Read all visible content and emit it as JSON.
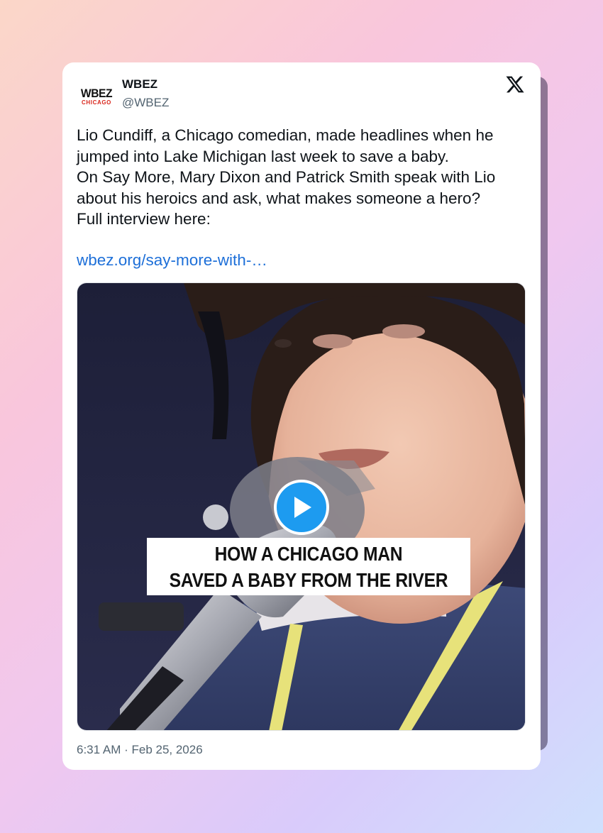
{
  "tweet": {
    "avatar": {
      "logo_main": "WBEZ",
      "logo_sub": "CHICAGO"
    },
    "display_name": "WBEZ",
    "handle": "@WBEZ",
    "text_lines": [
      "Lio Cundiff, a Chicago comedian, made headlines when he",
      "jumped into Lake Michigan last week to save a baby.",
      "On Say More, Mary Dixon and Patrick Smith speak with Lio",
      "about his heroics and ask, what makes someone a hero?",
      "Full interview here:"
    ],
    "link": "wbez.org/say-more-with-…",
    "video": {
      "caption_lines": [
        "HOW A CHICAGO MAN",
        "SAVED A BABY FROM THE RIVER"
      ]
    },
    "timestamp": "6:31 AM · Feb 25, 2026"
  },
  "icons": {
    "platform": "x-logo-icon",
    "play": "play-icon"
  },
  "colors": {
    "link": "#1d6fd8",
    "play_button": "#1d9bf0",
    "logo_red": "#d9261c",
    "text_primary": "#0f1419",
    "text_secondary": "#536471"
  }
}
